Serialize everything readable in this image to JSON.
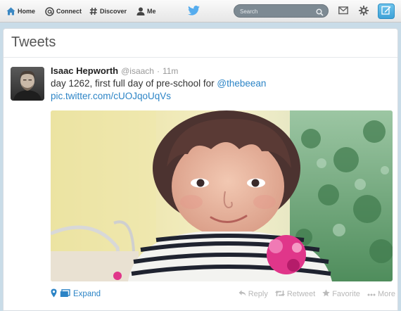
{
  "topbar": {
    "nav": {
      "home": "Home",
      "connect": "Connect",
      "discover": "Discover",
      "me": "Me"
    },
    "search_placeholder": "Search"
  },
  "timeline": {
    "title": "Tweets"
  },
  "tweet": {
    "fullname": "Isaac Hepworth",
    "handle": "@isaach",
    "separator": "·",
    "time": "11m",
    "text": "day 1262, first full day of pre-school for ",
    "mention": "@thebeean",
    "pic_link": "pic.twitter.com/cUOJqoUqVs"
  },
  "tweet_footer": {
    "expand": "Expand",
    "reply": "Reply",
    "retweet": "Retweet",
    "favorite": "Favorite",
    "more": "More"
  },
  "colors": {
    "link": "#2c84c6",
    "action_gray": "#b8b8b8",
    "twitter_blue": "#55acee"
  },
  "icons": [
    "home-icon",
    "at-icon",
    "hash-icon",
    "person-icon",
    "twitter-bird-icon",
    "search-icon",
    "envelope-icon",
    "gear-icon",
    "compose-icon",
    "location-pin-icon",
    "media-icon",
    "reply-icon",
    "retweet-icon",
    "star-icon",
    "more-dots-icon"
  ]
}
